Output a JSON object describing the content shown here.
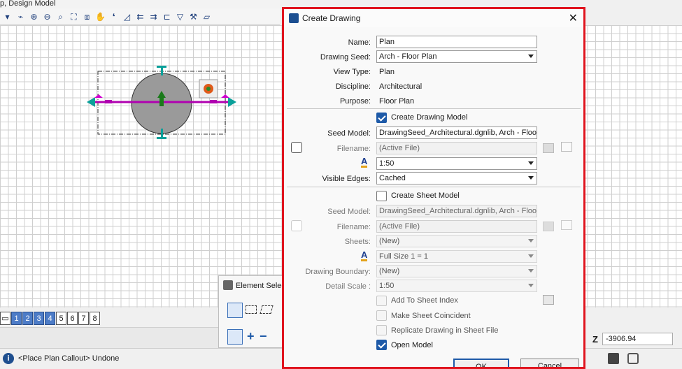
{
  "window": {
    "title": "p, Design Model"
  },
  "toolbar": {
    "icons": [
      "broom-icon",
      "zoom-in-icon",
      "zoom-out-icon",
      "zoom-window-icon",
      "fit-view-icon",
      "view-cube-icon",
      "pan-hand-icon",
      "walk-icon",
      "camera-icon",
      "prev-view-icon",
      "next-view-icon",
      "copy-view-icon",
      "view-display-icon",
      "render-icon",
      "saved-view-icon"
    ]
  },
  "view_tabs": [
    "1",
    "2",
    "3",
    "4",
    "5",
    "6",
    "7",
    "8"
  ],
  "element_panel": {
    "title": "Element Selec"
  },
  "status": {
    "message": "<Place Plan Callout> Undone"
  },
  "coords": {
    "z_label": "Z",
    "z_value": "-3906.94"
  },
  "dialog": {
    "title": "Create Drawing",
    "name_label": "Name:",
    "name_value": "Plan",
    "drawing_seed_label": "Drawing Seed:",
    "drawing_seed_value": "Arch - Floor Plan",
    "view_type_label": "View Type:",
    "view_type_value": "Plan",
    "discipline_label": "Discipline:",
    "discipline_value": "Architectural",
    "purpose_label": "Purpose:",
    "purpose_value": "Floor Plan",
    "drawing_model": {
      "checkbox_label": "Create Drawing Model",
      "checked": true,
      "seed_model_label": "Seed Model:",
      "seed_model_value": "DrawingSeed_Architectural.dgnlib, Arch - Floo",
      "filename_label": "Filename:",
      "filename_value": "(Active File)",
      "scale_value": "1:50",
      "visible_edges_label": "Visible Edges:",
      "visible_edges_value": "Cached"
    },
    "sheet_model": {
      "checkbox_label": "Create Sheet Model",
      "checked": false,
      "seed_model_label": "Seed Model:",
      "seed_model_value": "DrawingSeed_Architectural.dgnlib, Arch - Floo",
      "filename_label": "Filename:",
      "filename_value": "(Active File)",
      "sheets_label": "Sheets:",
      "sheets_value": "(New)",
      "scale_value": "Full Size 1 = 1",
      "drawing_boundary_label": "Drawing Boundary:",
      "drawing_boundary_value": "(New)",
      "detail_scale_label": "Detail Scale :",
      "detail_scale_value": "1:50"
    },
    "options": [
      {
        "label": "Add To Sheet Index",
        "checked": false
      },
      {
        "label": "Make Sheet Coincident",
        "checked": false
      },
      {
        "label": "Replicate Drawing in Sheet File",
        "checked": false
      },
      {
        "label": "Open Model",
        "checked": true
      }
    ],
    "ok_label": "OK",
    "cancel_label": "Cancel"
  },
  "colors": {
    "accent": "#1e5aa8",
    "highlight_border": "#e0141e",
    "element": "#b000b0",
    "handle": "#0aa09a"
  }
}
